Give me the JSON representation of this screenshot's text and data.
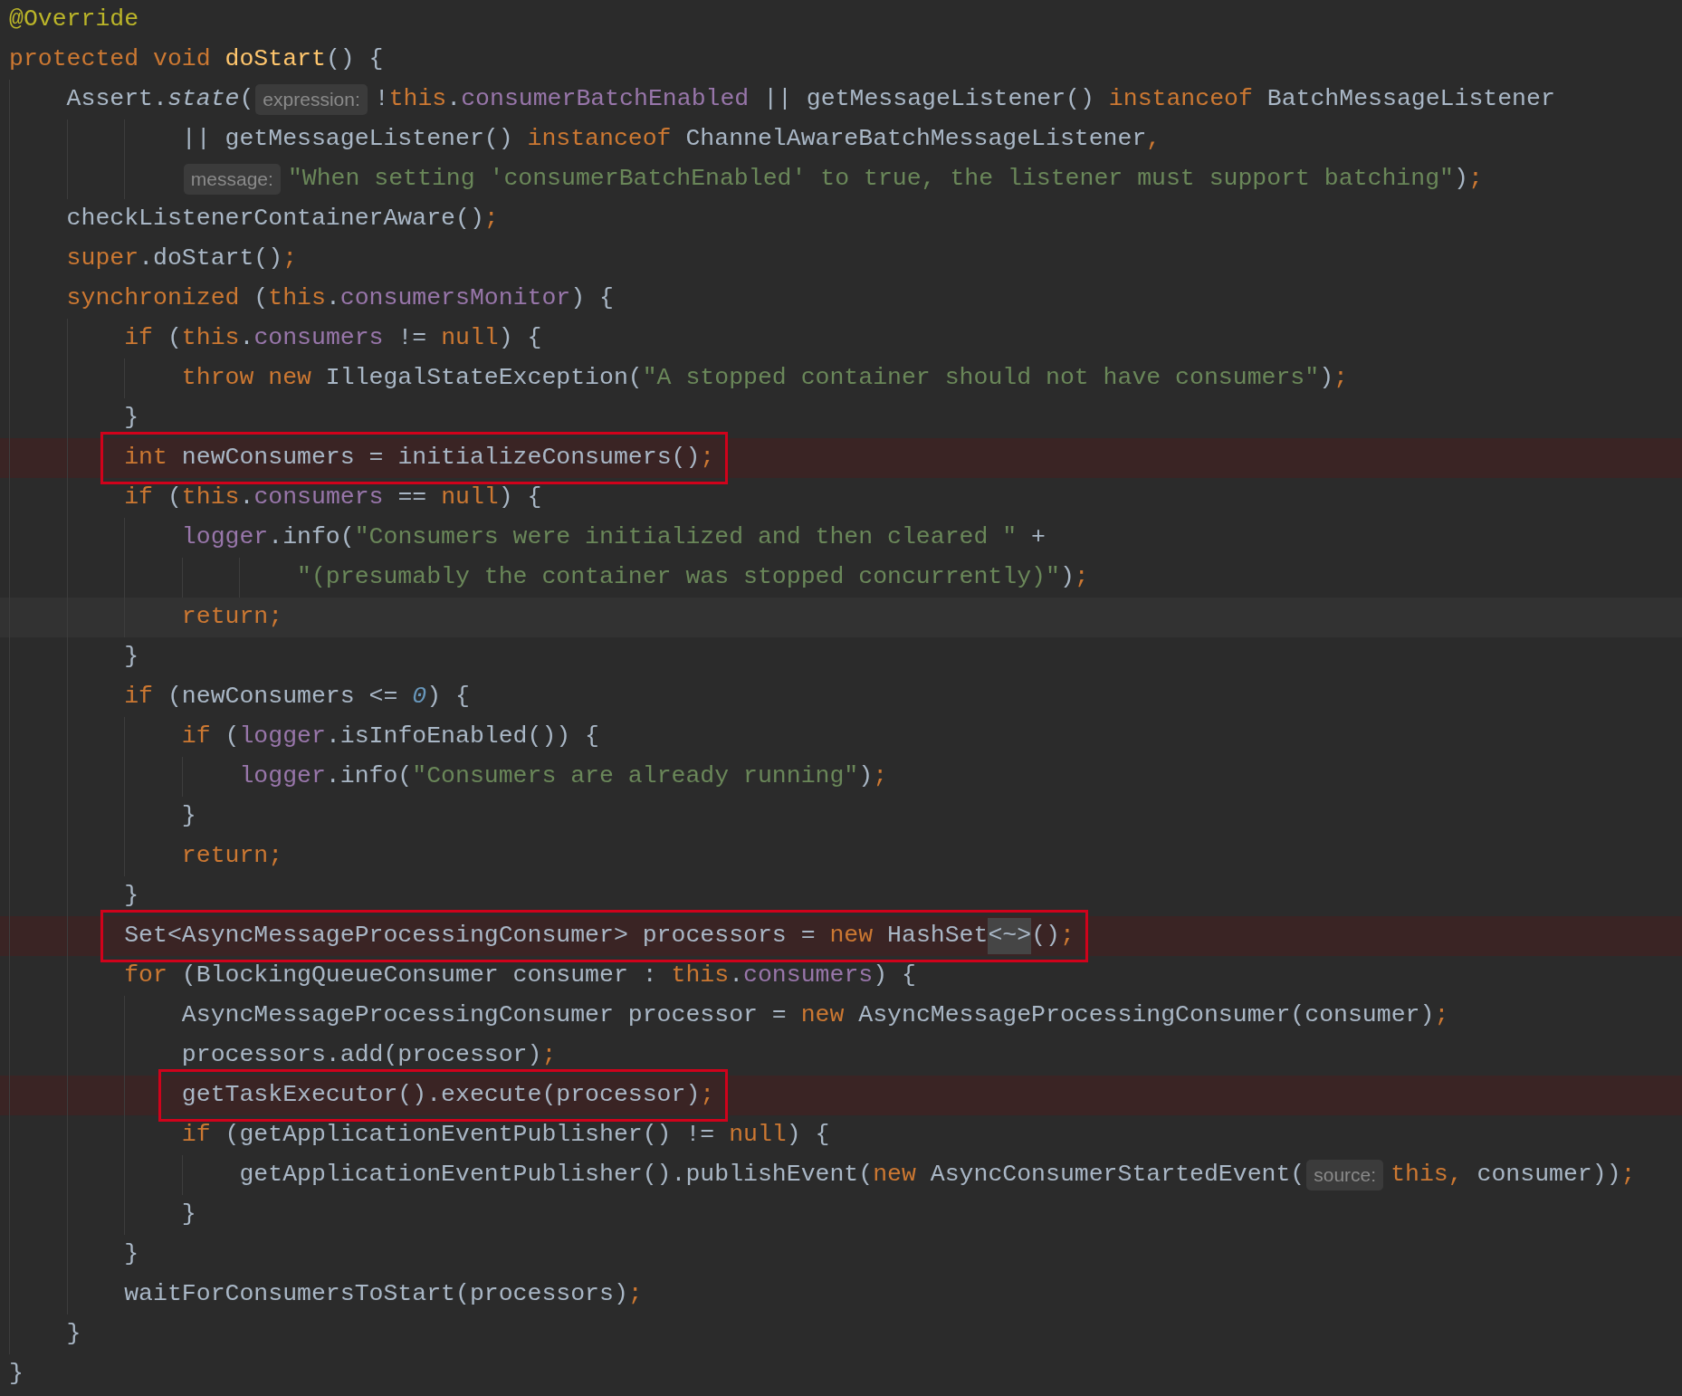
{
  "editor": {
    "lines": [
      {
        "tokens": [
          {
            "kind": "annotation",
            "text": "@Override"
          }
        ]
      },
      {
        "tokens": [
          {
            "kind": "keyword",
            "text": "protected void "
          },
          {
            "kind": "declaration",
            "text": "doStart"
          },
          {
            "kind": "plain",
            "text": "() {"
          }
        ],
        "children": [
          {
            "tokens": [
              {
                "kind": "plain",
                "text": "Assert."
              },
              {
                "kind": "static",
                "text": "state"
              },
              {
                "kind": "plain",
                "text": "("
              },
              {
                "kind": "hint",
                "text": "expression:"
              },
              {
                "kind": "plain",
                "text": "!"
              },
              {
                "kind": "keyword",
                "text": "this"
              },
              {
                "kind": "plain",
                "text": "."
              },
              {
                "kind": "field",
                "text": "consumerBatchEnabled"
              },
              {
                "kind": "plain",
                "text": " || getMessageListener() "
              },
              {
                "kind": "keyword",
                "text": "instanceof"
              },
              {
                "kind": "plain",
                "text": " BatchMessageListener"
              }
            ],
            "children": [
              {
                "children": [
                  {
                    "tokens": [
                      {
                        "kind": "plain",
                        "text": "|| getMessageListener() "
                      },
                      {
                        "kind": "keyword",
                        "text": "instanceof"
                      },
                      {
                        "kind": "plain",
                        "text": " ChannelAwareBatchMessageListener"
                      },
                      {
                        "kind": "keyword",
                        "text": ","
                      }
                    ]
                  },
                  {
                    "tokens": [
                      {
                        "kind": "hint",
                        "text": "message:"
                      },
                      {
                        "kind": "string",
                        "text": "\"When setting 'consumerBatchEnabled' to true, the listener must support batching\""
                      },
                      {
                        "kind": "plain",
                        "text": ")"
                      },
                      {
                        "kind": "keyword",
                        "text": ";"
                      }
                    ]
                  }
                ]
              }
            ]
          },
          {
            "tokens": [
              {
                "kind": "plain",
                "text": "checkListenerContainerAware()"
              },
              {
                "kind": "keyword",
                "text": ";"
              }
            ]
          },
          {
            "tokens": [
              {
                "kind": "keyword",
                "text": "super"
              },
              {
                "kind": "plain",
                "text": ".doStart()"
              },
              {
                "kind": "keyword",
                "text": ";"
              }
            ]
          },
          {
            "tokens": [
              {
                "kind": "keyword",
                "text": "synchronized"
              },
              {
                "kind": "plain",
                "text": " ("
              },
              {
                "kind": "keyword",
                "text": "this"
              },
              {
                "kind": "plain",
                "text": "."
              },
              {
                "kind": "field",
                "text": "consumersMonitor"
              },
              {
                "kind": "plain",
                "text": ") {"
              }
            ],
            "children": [
              {
                "tokens": [
                  {
                    "kind": "keyword",
                    "text": "if"
                  },
                  {
                    "kind": "plain",
                    "text": " ("
                  },
                  {
                    "kind": "keyword",
                    "text": "this"
                  },
                  {
                    "kind": "plain",
                    "text": "."
                  },
                  {
                    "kind": "field",
                    "text": "consumers"
                  },
                  {
                    "kind": "plain",
                    "text": " != "
                  },
                  {
                    "kind": "keyword",
                    "text": "null"
                  },
                  {
                    "kind": "plain",
                    "text": ") {"
                  }
                ],
                "children": [
                  {
                    "tokens": [
                      {
                        "kind": "keyword",
                        "text": "throw new "
                      },
                      {
                        "kind": "plain",
                        "text": "IllegalStateException("
                      },
                      {
                        "kind": "string",
                        "text": "\"A stopped container should not have consumers\""
                      },
                      {
                        "kind": "plain",
                        "text": ")"
                      },
                      {
                        "kind": "keyword",
                        "text": ";"
                      }
                    ]
                  }
                ]
              },
              {
                "tokens": [
                  {
                    "kind": "plain",
                    "text": "}"
                  }
                ]
              },
              {
                "highlighted": true,
                "boxed": true,
                "tokens": [
                  {
                    "kind": "keyword",
                    "text": "int "
                  },
                  {
                    "kind": "plain",
                    "text": "newConsumers = initializeConsumers()"
                  },
                  {
                    "kind": "keyword",
                    "text": ";"
                  }
                ]
              },
              {
                "tokens": [
                  {
                    "kind": "keyword",
                    "text": "if"
                  },
                  {
                    "kind": "plain",
                    "text": " ("
                  },
                  {
                    "kind": "keyword",
                    "text": "this"
                  },
                  {
                    "kind": "plain",
                    "text": "."
                  },
                  {
                    "kind": "field",
                    "text": "consumers"
                  },
                  {
                    "kind": "plain",
                    "text": " == "
                  },
                  {
                    "kind": "keyword",
                    "text": "null"
                  },
                  {
                    "kind": "plain",
                    "text": ") {"
                  }
                ],
                "children": [
                  {
                    "tokens": [
                      {
                        "kind": "field",
                        "text": "logger"
                      },
                      {
                        "kind": "plain",
                        "text": ".info("
                      },
                      {
                        "kind": "string",
                        "text": "\"Consumers were initialized and then cleared \""
                      },
                      {
                        "kind": "plain",
                        "text": " +"
                      }
                    ],
                    "children": [
                      {
                        "children": [
                          {
                            "tokens": [
                              {
                                "kind": "string",
                                "text": "\"(presumably the container was stopped concurrently)\""
                              },
                              {
                                "kind": "plain",
                                "text": ")"
                              },
                              {
                                "kind": "keyword",
                                "text": ";"
                              }
                            ]
                          }
                        ]
                      }
                    ]
                  },
                  {
                    "current": true,
                    "tokens": [
                      {
                        "kind": "keyword",
                        "text": "return;"
                      }
                    ]
                  }
                ]
              },
              {
                "tokens": [
                  {
                    "kind": "plain",
                    "text": "}"
                  }
                ]
              },
              {
                "tokens": [
                  {
                    "kind": "keyword",
                    "text": "if"
                  },
                  {
                    "kind": "plain",
                    "text": " (newConsumers <= "
                  },
                  {
                    "kind": "number",
                    "text": "0"
                  },
                  {
                    "kind": "plain",
                    "text": ") {"
                  }
                ],
                "children": [
                  {
                    "tokens": [
                      {
                        "kind": "keyword",
                        "text": "if"
                      },
                      {
                        "kind": "plain",
                        "text": " ("
                      },
                      {
                        "kind": "field",
                        "text": "logger"
                      },
                      {
                        "kind": "plain",
                        "text": ".isInfoEnabled()) {"
                      }
                    ],
                    "children": [
                      {
                        "tokens": [
                          {
                            "kind": "field",
                            "text": "logger"
                          },
                          {
                            "kind": "plain",
                            "text": ".info("
                          },
                          {
                            "kind": "string",
                            "text": "\"Consumers are already running\""
                          },
                          {
                            "kind": "plain",
                            "text": ")"
                          },
                          {
                            "kind": "keyword",
                            "text": ";"
                          }
                        ]
                      }
                    ]
                  },
                  {
                    "tokens": [
                      {
                        "kind": "plain",
                        "text": "}"
                      }
                    ]
                  },
                  {
                    "tokens": [
                      {
                        "kind": "keyword",
                        "text": "return;"
                      }
                    ]
                  }
                ]
              },
              {
                "tokens": [
                  {
                    "kind": "plain",
                    "text": "}"
                  }
                ]
              },
              {
                "highlighted": true,
                "boxed": true,
                "tokens": [
                  {
                    "kind": "plain",
                    "text": "Set<AsyncMessageProcessingConsumer> processors = "
                  },
                  {
                    "kind": "keyword",
                    "text": "new "
                  },
                  {
                    "kind": "plain",
                    "text": "HashSet"
                  },
                  {
                    "kind": "folded",
                    "text": "<~>"
                  },
                  {
                    "kind": "plain",
                    "text": "()"
                  },
                  {
                    "kind": "keyword",
                    "text": ";"
                  }
                ]
              },
              {
                "tokens": [
                  {
                    "kind": "keyword",
                    "text": "for"
                  },
                  {
                    "kind": "plain",
                    "text": " (BlockingQueueConsumer consumer : "
                  },
                  {
                    "kind": "keyword",
                    "text": "this"
                  },
                  {
                    "kind": "plain",
                    "text": "."
                  },
                  {
                    "kind": "field",
                    "text": "consumers"
                  },
                  {
                    "kind": "plain",
                    "text": ") {"
                  }
                ],
                "children": [
                  {
                    "tokens": [
                      {
                        "kind": "plain",
                        "text": "AsyncMessageProcessingConsumer processor = "
                      },
                      {
                        "kind": "keyword",
                        "text": "new "
                      },
                      {
                        "kind": "plain",
                        "text": "AsyncMessageProcessingConsumer(consumer)"
                      },
                      {
                        "kind": "keyword",
                        "text": ";"
                      }
                    ]
                  },
                  {
                    "tokens": [
                      {
                        "kind": "plain",
                        "text": "processors.add(processor)"
                      },
                      {
                        "kind": "keyword",
                        "text": ";"
                      }
                    ]
                  },
                  {
                    "highlighted": true,
                    "boxed": true,
                    "tokens": [
                      {
                        "kind": "plain",
                        "text": "getTaskExecutor().execute(processor)"
                      },
                      {
                        "kind": "keyword",
                        "text": ";"
                      }
                    ]
                  },
                  {
                    "tokens": [
                      {
                        "kind": "keyword",
                        "text": "if"
                      },
                      {
                        "kind": "plain",
                        "text": " (getApplicationEventPublisher() != "
                      },
                      {
                        "kind": "keyword",
                        "text": "null"
                      },
                      {
                        "kind": "plain",
                        "text": ") {"
                      }
                    ],
                    "children": [
                      {
                        "tokens": [
                          {
                            "kind": "plain",
                            "text": "getApplicationEventPublisher().publishEvent("
                          },
                          {
                            "kind": "keyword",
                            "text": "new "
                          },
                          {
                            "kind": "plain",
                            "text": "AsyncConsumerStartedEvent("
                          },
                          {
                            "kind": "hint",
                            "text": "source:"
                          },
                          {
                            "kind": "keyword",
                            "text": "this,"
                          },
                          {
                            "kind": "plain",
                            "text": " consumer))"
                          },
                          {
                            "kind": "keyword",
                            "text": ";"
                          }
                        ]
                      }
                    ]
                  },
                  {
                    "tokens": [
                      {
                        "kind": "plain",
                        "text": "}"
                      }
                    ]
                  }
                ]
              },
              {
                "tokens": [
                  {
                    "kind": "plain",
                    "text": "}"
                  }
                ]
              },
              {
                "tokens": [
                  {
                    "kind": "plain",
                    "text": "waitForConsumersToStart(processors)"
                  },
                  {
                    "kind": "keyword",
                    "text": ";"
                  }
                ]
              }
            ]
          },
          {
            "tokens": [
              {
                "kind": "plain",
                "text": "}"
              }
            ]
          }
        ]
      },
      {
        "tokens": [
          {
            "kind": "plain",
            "text": "}"
          }
        ]
      }
    ]
  }
}
